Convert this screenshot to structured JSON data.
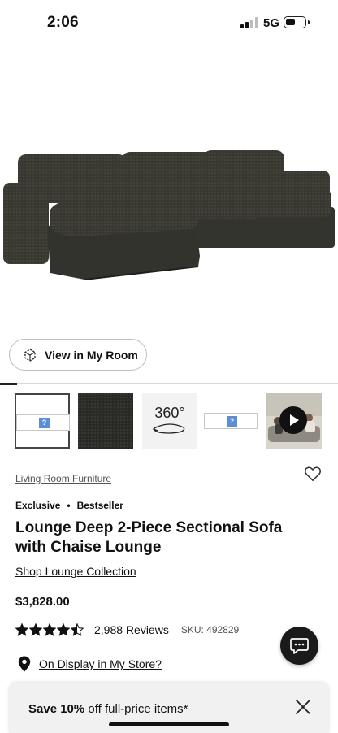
{
  "status_bar": {
    "time": "2:06",
    "network": "5G",
    "signal_bars_active": 2,
    "signal_bars_total": 4,
    "battery_level": 0.4
  },
  "gallery": {
    "view_in_room_label": "View in My Room",
    "progress": 0.05,
    "thumbnails": [
      {
        "kind": "broken-image",
        "selected": true
      },
      {
        "kind": "fabric-swatch",
        "selected": false
      },
      {
        "kind": "360-view",
        "label": "360°",
        "selected": false
      },
      {
        "kind": "broken-image",
        "selected": false
      },
      {
        "kind": "video",
        "selected": false
      }
    ]
  },
  "product": {
    "category": "Living Room Furniture",
    "badges": [
      "Exclusive",
      "Bestseller"
    ],
    "badge_separator": "•",
    "title": "Lounge Deep 2-Piece Sectional Sofa with Chaise Lounge",
    "collection_link": "Shop Lounge Collection",
    "price": "$3,828.00",
    "rating": 4.5,
    "reviews_label": "2,988 Reviews",
    "sku_label": "SKU: 492829",
    "store_link": "On Display in My Store?"
  },
  "promo": {
    "bold": "Save 10%",
    "rest": " off full-price items*"
  },
  "colors": {
    "accent": "#111111",
    "sofa_fabric": "#3a3a33",
    "muted_text": "#555555",
    "promo_bg": "#f1f1f1"
  },
  "icons": [
    "view-in-room-icon",
    "heart-icon",
    "star-icon",
    "map-pin-icon",
    "chat-icon",
    "close-icon",
    "play-icon"
  ]
}
